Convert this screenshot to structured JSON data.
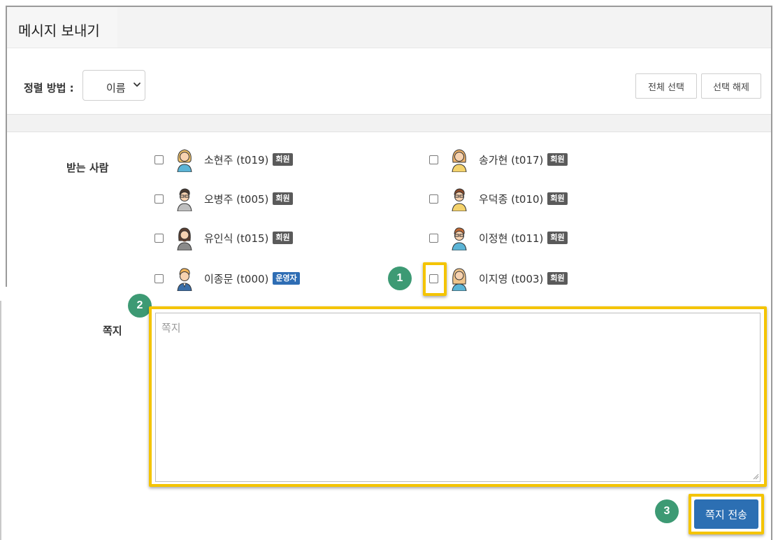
{
  "dialog": {
    "title": "메시지 보내기"
  },
  "toolbar": {
    "sort_label": "정렬 방법 :",
    "sort_value": "이름",
    "select_all_label": "전체 선택",
    "deselect_label": "선택 해제"
  },
  "recipients": {
    "label": "받는 사람",
    "items": [
      {
        "name": "소현주 (t019)",
        "badge": "회원",
        "checked": false,
        "avatar": "woman-avatar-icon"
      },
      {
        "name": "송가현 (t017)",
        "badge": "회원",
        "checked": false,
        "avatar": "woman-avatar-icon"
      },
      {
        "name": "오병주 (t005)",
        "badge": "회원",
        "checked": false,
        "avatar": "man-glasses-avatar-icon"
      },
      {
        "name": "우덕종 (t010)",
        "badge": "회원",
        "checked": false,
        "avatar": "man-glasses-avatar-icon"
      },
      {
        "name": "유인식 (t015)",
        "badge": "회원",
        "checked": false,
        "avatar": "bearded-man-avatar-icon"
      },
      {
        "name": "이정현 (t011)",
        "badge": "회원",
        "checked": false,
        "avatar": "man-glasses-avatar-icon"
      },
      {
        "name": "이종문 (t000)",
        "badge": "운영자",
        "checked": false,
        "avatar": "man-avatar-icon"
      },
      {
        "name": "이지영 (t003)",
        "badge": "회원",
        "checked": false,
        "avatar": "woman-avatar-icon"
      }
    ]
  },
  "memo": {
    "label": "쪽지",
    "placeholder": "쪽지",
    "value": ""
  },
  "send_button": {
    "label": "쪽지 전송"
  },
  "callouts": {
    "step1": "1",
    "step2": "2",
    "step3": "3"
  },
  "colors": {
    "highlight": "#f4c400",
    "callout": "#3d9a74",
    "primary_button": "#2c6fb3",
    "operator_badge": "#2e6db4",
    "member_badge": "#5a5a5a"
  }
}
